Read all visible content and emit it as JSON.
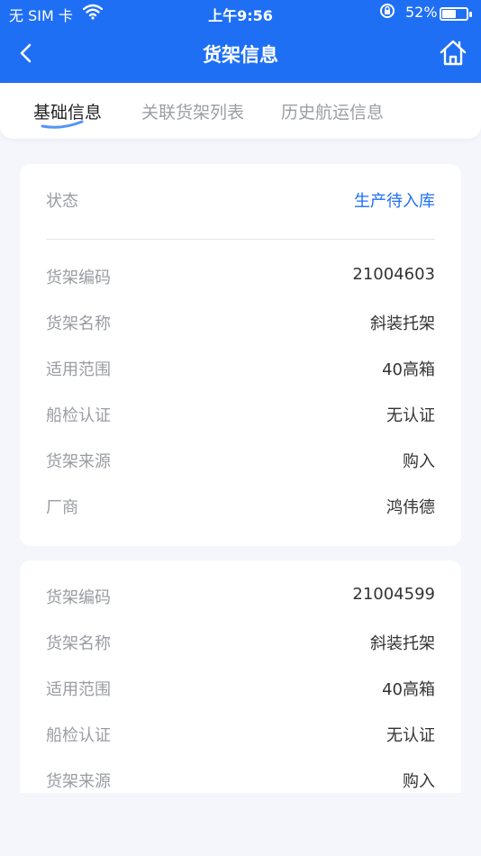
{
  "status_bar": {
    "carrier": "无 SIM 卡",
    "time": "上午9:56",
    "battery": "52%"
  },
  "nav": {
    "title": "货架信息"
  },
  "tabs": [
    {
      "label": "基础信息"
    },
    {
      "label": "关联货架列表"
    },
    {
      "label": "历史航运信息"
    }
  ],
  "card1": {
    "status_label": "状态",
    "status_value": "生产待入库",
    "rows": [
      {
        "label": "货架编码",
        "value": "21004603"
      },
      {
        "label": "货架名称",
        "value": "斜装托架"
      },
      {
        "label": "适用范围",
        "value": "40高箱"
      },
      {
        "label": "船检认证",
        "value": "无认证"
      },
      {
        "label": "货架来源",
        "value": "购入"
      },
      {
        "label": "厂商",
        "value": "鸿伟德"
      }
    ]
  },
  "card2": {
    "rows": [
      {
        "label": "货架编码",
        "value": "21004599"
      },
      {
        "label": "货架名称",
        "value": "斜装托架"
      },
      {
        "label": "适用范围",
        "value": "40高箱"
      },
      {
        "label": "船检认证",
        "value": "无认证"
      },
      {
        "label": "货架来源",
        "value": "购入"
      }
    ]
  },
  "colors": {
    "primary": "#1f6ff5",
    "label": "#999ca3",
    "value": "#333333",
    "background": "#f4f6fb"
  }
}
